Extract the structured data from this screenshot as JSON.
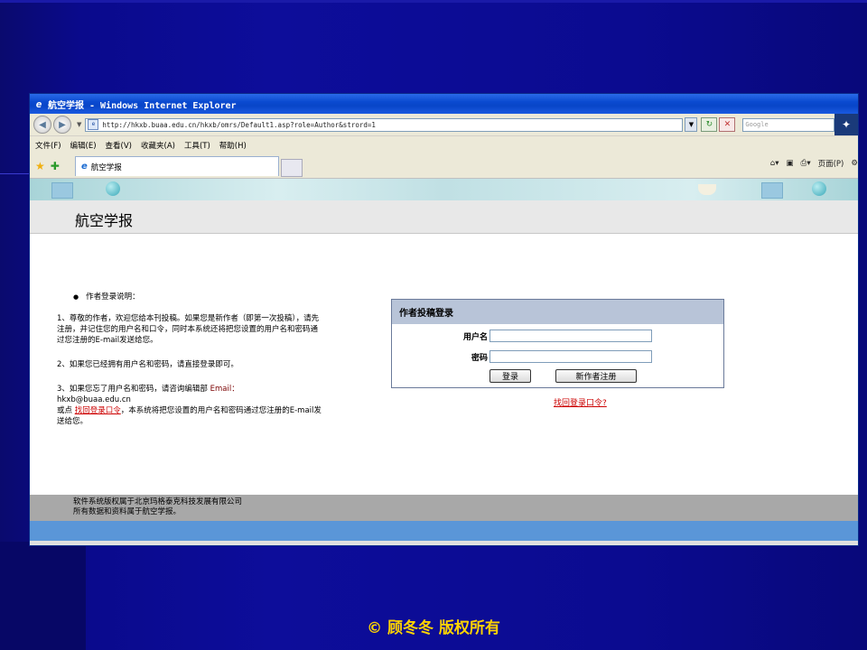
{
  "window": {
    "title": "航空学报 - Windows Internet Explorer",
    "url": "http://hkxb.buaa.edu.cn/hkxb/omrs/Default1.asp?role=Author&strord=1",
    "search_placeholder": "Google"
  },
  "menu": [
    "文件(F)",
    "编辑(E)",
    "查看(V)",
    "收藏夹(A)",
    "工具(T)",
    "帮助(H)"
  ],
  "tab": {
    "label": "航空学报"
  },
  "toolbar_right": {
    "page": "页面(P)",
    "tools_icon": "gear"
  },
  "site": {
    "title": "航空学报"
  },
  "instructions": {
    "heading": "作者登录说明：",
    "p1": "1、尊敬的作者，欢迎您给本刊投稿。如果您是新作者（即第一次投稿），请先注册，并记住您的用户名和口令，同时本系统还将把您设置的用户名和密码通过您注册的E-mail发送给您。",
    "p2": "2、如果您已经拥有用户名和密码，请直接登录即可。",
    "p3_prefix": "3、如果您忘了用户名和密码，请咨询编辑部",
    "p3_email_label": "Email：",
    "p3_email": "hkxb@buaa.edu.cn",
    "p3_or": "或点",
    "p3_link": "找回登录口令",
    "p3_suffix": "，本系统将把您设置的用户名和密码通过您注册的E-mail发送给您。"
  },
  "login": {
    "heading": "作者投稿登录",
    "username_label": "用户名",
    "password_label": "密码",
    "login_button": "登录",
    "register_button": "新作者注册",
    "forgot_link": "找回登录口令?"
  },
  "footer": {
    "line1": "软件系统版权属于北京玛格泰克科技发展有限公司",
    "line2": "所有数据和资料属于航空学报。"
  },
  "slide": {
    "copyright": "© 顾冬冬 版权所有"
  },
  "colors": {
    "slide_bg": "#0b0b8c",
    "copyright": "#ffd400",
    "titlebar": "#0a4ad0",
    "link_red": "#cc0000",
    "footer_gray": "#a8a8a8",
    "footer_blue": "#5a96d8"
  }
}
